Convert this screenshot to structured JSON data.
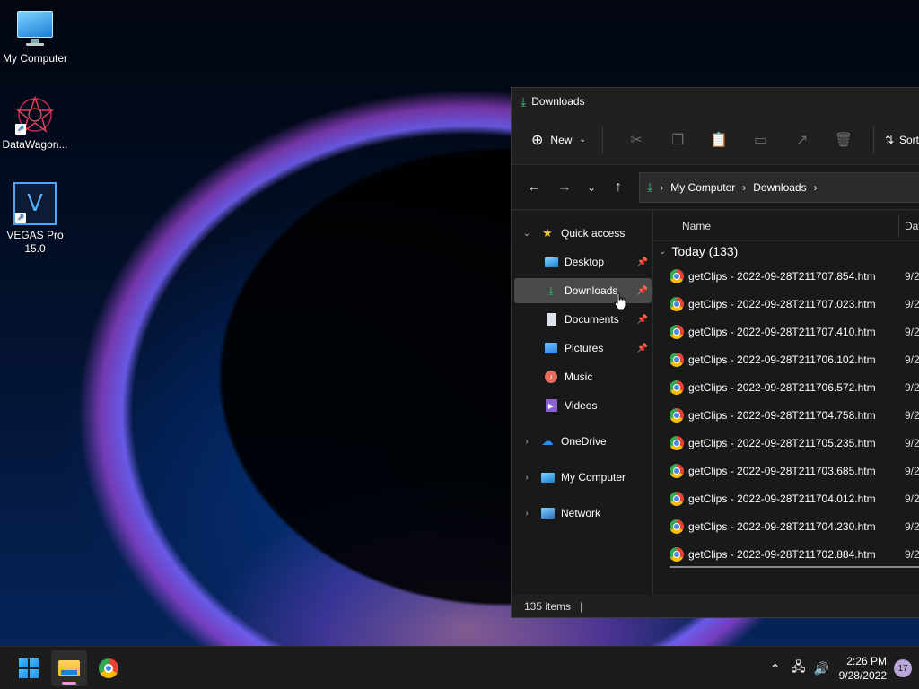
{
  "desktop": {
    "icons": [
      {
        "label": "My Computer",
        "icon": "monitor-icon"
      },
      {
        "label": "DataWagon...",
        "icon": "datawagon-icon"
      },
      {
        "label": "VEGAS Pro 15.0",
        "icon": "vegas-icon"
      }
    ]
  },
  "explorer": {
    "title": "Downloads",
    "toolbar": {
      "new_label": "New",
      "sort_label": "Sort",
      "icons": [
        "cut-icon",
        "copy-icon",
        "paste-icon",
        "rename-icon",
        "share-icon",
        "delete-icon"
      ]
    },
    "address": {
      "crumbs": [
        "My Computer",
        "Downloads"
      ]
    },
    "nav": {
      "quick_access": "Quick access",
      "items": [
        {
          "label": "Desktop",
          "icon": "desktop-icon",
          "pinned": true
        },
        {
          "label": "Downloads",
          "icon": "download-icon",
          "pinned": true,
          "selected": true
        },
        {
          "label": "Documents",
          "icon": "documents-icon",
          "pinned": true
        },
        {
          "label": "Pictures",
          "icon": "pictures-icon",
          "pinned": true
        },
        {
          "label": "Music",
          "icon": "music-icon"
        },
        {
          "label": "Videos",
          "icon": "videos-icon"
        }
      ],
      "roots": [
        {
          "label": "OneDrive",
          "icon": "onedrive-icon"
        },
        {
          "label": "My Computer",
          "icon": "monitor-icon"
        },
        {
          "label": "Network",
          "icon": "network-icon"
        }
      ]
    },
    "columns": {
      "name": "Name",
      "date": "Dat"
    },
    "group": "Today (133)",
    "files": [
      {
        "name": "getClips - 2022-09-28T211707.854.htm",
        "date": "9/2"
      },
      {
        "name": "getClips - 2022-09-28T211707.023.htm",
        "date": "9/2"
      },
      {
        "name": "getClips - 2022-09-28T211707.410.htm",
        "date": "9/2"
      },
      {
        "name": "getClips - 2022-09-28T211706.102.htm",
        "date": "9/2"
      },
      {
        "name": "getClips - 2022-09-28T211706.572.htm",
        "date": "9/2"
      },
      {
        "name": "getClips - 2022-09-28T211704.758.htm",
        "date": "9/2"
      },
      {
        "name": "getClips - 2022-09-28T211705.235.htm",
        "date": "9/2"
      },
      {
        "name": "getClips - 2022-09-28T211703.685.htm",
        "date": "9/2"
      },
      {
        "name": "getClips - 2022-09-28T211704.012.htm",
        "date": "9/2"
      },
      {
        "name": "getClips - 2022-09-28T211704.230.htm",
        "date": "9/2"
      },
      {
        "name": "getClips - 2022-09-28T211702.884.htm",
        "date": "9/2"
      }
    ],
    "status": "135 items"
  },
  "taskbar": {
    "time": "2:26 PM",
    "date": "9/28/2022",
    "notifications": "17"
  }
}
